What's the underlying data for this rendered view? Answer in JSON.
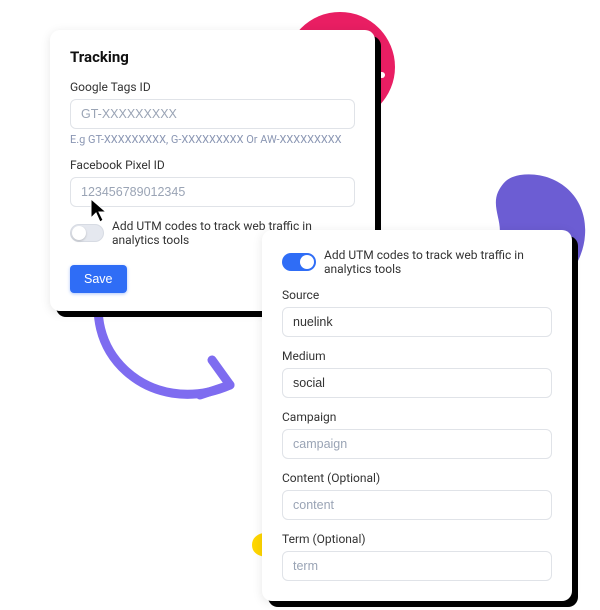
{
  "card1": {
    "heading": "Tracking",
    "google": {
      "label": "Google Tags ID",
      "placeholder": "GT-XXXXXXXXX",
      "hint": "E.g GT-XXXXXXXXX, G-XXXXXXXXX Or AW-XXXXXXXXX"
    },
    "facebook": {
      "label": "Facebook Pixel ID",
      "placeholder": "123456789012345"
    },
    "utm_toggle_label": "Add UTM codes to track web traffic in analytics tools",
    "save": "Save"
  },
  "card2": {
    "utm_toggle_label": "Add UTM codes to track web traffic in analytics tools",
    "source": {
      "label": "Source",
      "value": "nuelink"
    },
    "medium": {
      "label": "Medium",
      "value": "social"
    },
    "campaign": {
      "label": "Campaign",
      "placeholder": "campaign"
    },
    "content": {
      "label": "Content (Optional)",
      "placeholder": "content"
    },
    "term": {
      "label": "Term (Optional)",
      "placeholder": "term"
    }
  }
}
